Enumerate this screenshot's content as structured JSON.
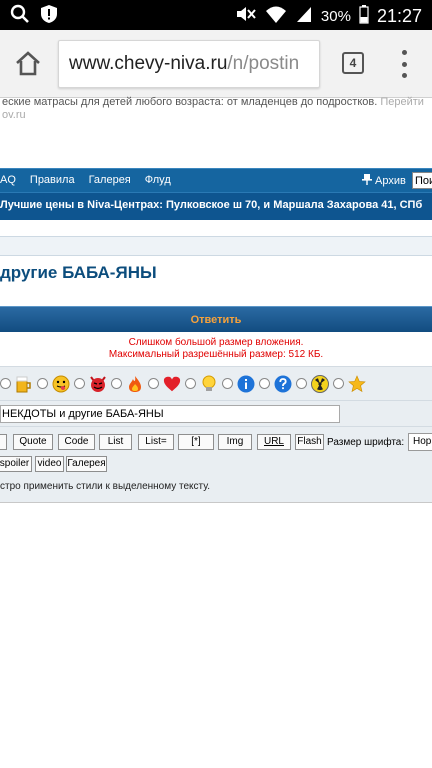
{
  "status_bar": {
    "battery": "30%",
    "time": "21:27"
  },
  "browser": {
    "url_host": "www.chevy-niva.ru",
    "url_path": "/n/postin",
    "tab_count": "4"
  },
  "ad": {
    "text": "еские матрасы для детей любого возраста: от младенцев до подростков.",
    "link": "Перейти",
    "line2": "ov.ru"
  },
  "nav": {
    "items": [
      "AQ",
      "Правила",
      "Галерея",
      "Флуд"
    ],
    "archive": "Архив",
    "search_value": "Поис"
  },
  "promo": "Лучшие цены в Niva-Центрах: Пулковское ш 70, и Маршала Захарова 41, СПб",
  "topic_title": "другие БАБА-ЯНЫ",
  "reply_label": "Ответить",
  "error": {
    "line1": "Слишком большой размер вложения.",
    "line2": "Максимальный разрешённый размер: 512 КБ."
  },
  "smileys": [
    "beer-icon",
    "tongue-smiley-icon",
    "devil-icon",
    "fire-icon",
    "heart-icon",
    "lightbulb-icon",
    "info-icon",
    "question-icon",
    "radioactive-icon",
    "star-icon"
  ],
  "subject_value": "НЕКДОТЫ и другие БАБА-ЯНЫ",
  "bbcode": {
    "row1": [
      "",
      "Quote",
      "Code",
      "List",
      "List=",
      "[*]",
      "Img",
      "URL",
      "Flash"
    ],
    "font_size_label": "Размер шрифта:",
    "font_size_value": "Нор",
    "row2": [
      "spoiler",
      "video",
      "Галерея"
    ],
    "hint": "стро применить стили к выделенному тексту."
  },
  "colors": {
    "nav_bg": "#1565a0",
    "promo_bg": "#0e5590",
    "title": "#0c4d7d",
    "reply_text": "#f7a23b",
    "error": "#e00000",
    "panel_bg": "#e9eef2"
  }
}
